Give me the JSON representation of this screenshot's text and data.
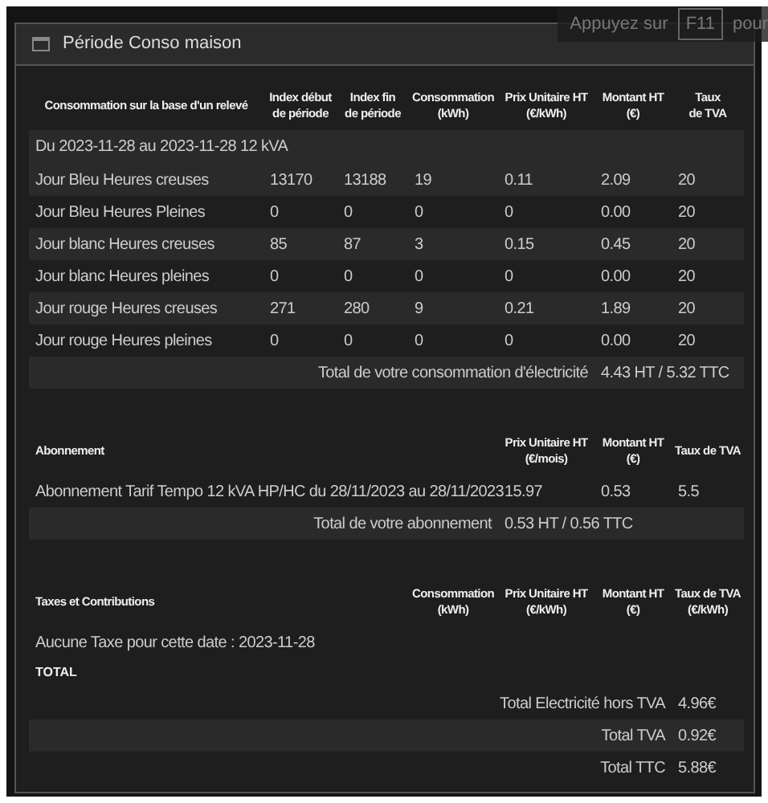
{
  "window": {
    "title": "Période Conso maison"
  },
  "fullscreen_hint": {
    "before": "Appuyez sur",
    "key": "F11",
    "after": "pour"
  },
  "consumption": {
    "columns": [
      "Consommation sur la base d'un relevé",
      "Index début\nde période",
      "Index fin\nde période",
      "Consommation\n(kWh)",
      "Prix Unitaire HT\n(€/kWh)",
      "Montant HT\n(€)",
      "Taux\nde TVA"
    ],
    "period": "Du 2023-11-28 au 2023-11-28 12 kVA",
    "rows": [
      {
        "cells": [
          "Jour Bleu Heures creuses",
          "13170",
          "13188",
          "19",
          "0.11",
          "2.09",
          "20"
        ]
      },
      {
        "cells": [
          "Jour Bleu Heures Pleines",
          "0",
          "0",
          "0",
          "0",
          "0.00",
          "20"
        ]
      },
      {
        "cells": [
          "Jour blanc Heures creuses",
          "85",
          "87",
          "3",
          "0.15",
          "0.45",
          "20"
        ]
      },
      {
        "cells": [
          "Jour blanc Heures pleines",
          "0",
          "0",
          "0",
          "0",
          "0.00",
          "20"
        ]
      },
      {
        "cells": [
          "Jour rouge Heures creuses",
          "271",
          "280",
          "9",
          "0.21",
          "1.89",
          "20"
        ]
      },
      {
        "cells": [
          "Jour rouge Heures pleines",
          "0",
          "0",
          "0",
          "0",
          "0.00",
          "20"
        ]
      }
    ],
    "total": {
      "label": "Total de votre consommation d'électricité",
      "value": "4.43 HT / 5.32 TTC"
    }
  },
  "subscription": {
    "columns": [
      "Abonnement",
      "Prix Unitaire HT\n(€/mois)",
      "Montant HT\n(€)",
      "Taux de TVA"
    ],
    "rows": [
      {
        "cells": [
          "Abonnement Tarif Tempo 12 kVA HP/HC du 28/11/2023 au 28/11/2023",
          "15.97",
          "0.53",
          "5.5"
        ]
      }
    ],
    "total": {
      "label": "Total de votre abonnement",
      "value": "0.53 HT / 0.56 TTC"
    }
  },
  "taxes": {
    "columns": [
      "Taxes et Contributions",
      "Consommation\n(kWh)",
      "Prix Unitaire HT\n(€/kWh)",
      "Montant HT\n(€)",
      "Taux de TVA\n(€/kWh)"
    ],
    "note": "Aucune Taxe pour cette date : 2023-11-28"
  },
  "totals": {
    "heading": "TOTAL",
    "rows": [
      {
        "label": "Total Electricité hors TVA",
        "value": "4.96€"
      },
      {
        "label": "Total TVA",
        "value": "0.92€"
      },
      {
        "label": "Total TTC",
        "value": "5.88€"
      }
    ]
  }
}
